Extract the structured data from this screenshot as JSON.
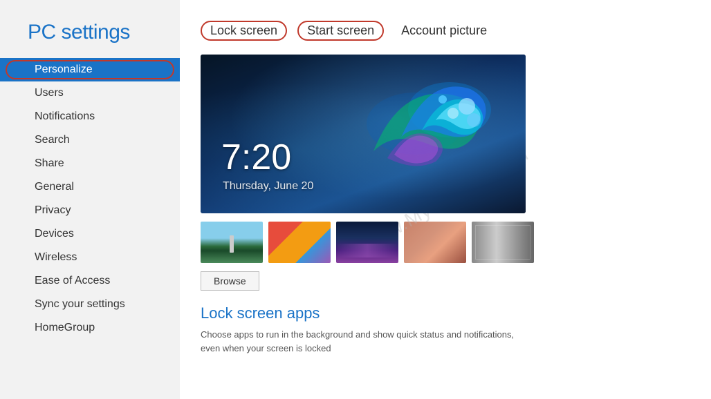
{
  "sidebar": {
    "title": "PC settings",
    "items": [
      {
        "id": "personalize",
        "label": "Personalize",
        "active": true
      },
      {
        "id": "users",
        "label": "Users",
        "active": false
      },
      {
        "id": "notifications",
        "label": "Notifications",
        "active": false
      },
      {
        "id": "search",
        "label": "Search",
        "active": false
      },
      {
        "id": "share",
        "label": "Share",
        "active": false
      },
      {
        "id": "general",
        "label": "General",
        "active": false
      },
      {
        "id": "privacy",
        "label": "Privacy",
        "active": false
      },
      {
        "id": "devices",
        "label": "Devices",
        "active": false
      },
      {
        "id": "wireless",
        "label": "Wireless",
        "active": false
      },
      {
        "id": "ease-of-access",
        "label": "Ease of Access",
        "active": false
      },
      {
        "id": "sync-settings",
        "label": "Sync your settings",
        "active": false
      },
      {
        "id": "homegroup",
        "label": "HomeGroup",
        "active": false
      }
    ]
  },
  "main": {
    "tabs": [
      {
        "id": "lock-screen",
        "label": "Lock screen",
        "circled": true
      },
      {
        "id": "start-screen",
        "label": "Start screen",
        "circled": true
      },
      {
        "id": "account-picture",
        "label": "Account picture",
        "circled": false
      }
    ],
    "lock_preview": {
      "time": "7:20",
      "date": "Thursday, June 20"
    },
    "browse_button": "Browse",
    "lock_apps_section": {
      "title": "Lock screen apps",
      "description": "Choose apps to run in the background and show quick status and notifications, even when your screen is locked"
    },
    "watermark": "www.MyTecBits.com"
  }
}
